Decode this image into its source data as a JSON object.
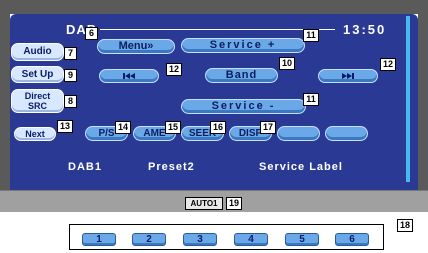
{
  "header": {
    "title": "DAB",
    "time": "13:50"
  },
  "side_buttons": {
    "audio": "Audio",
    "setup": "Set Up",
    "direct_line1": "Direct",
    "direct_line2": "SRC"
  },
  "top_buttons": {
    "menu": "Menu»",
    "service_up": "Service +",
    "band": "Band",
    "service_down": "Service -"
  },
  "function_row": {
    "next": "Next",
    "ps": "P/S",
    "am": "AME",
    "seek": "SEEK",
    "disp": "DISP",
    "blank1": "",
    "blank2": ""
  },
  "info": {
    "band": "DAB1",
    "preset": "Preset2",
    "service": "Service Label"
  },
  "auto": "AUTO1",
  "presets": [
    "1",
    "2",
    "3",
    "4",
    "5",
    "6"
  ],
  "callouts": {
    "c6": "6",
    "c7": "7",
    "c8": "8",
    "c9": "9",
    "c10": "10",
    "c11a": "11",
    "c11b": "11",
    "c12a": "12",
    "c12b": "12",
    "c13": "13",
    "c14": "14",
    "c15": "15",
    "c16": "16",
    "c17": "17",
    "c18": "18",
    "c19": "19"
  },
  "colors": {
    "display_bg": "#2a3a94",
    "button": "#6aa8e8",
    "accent": "#48b8f0",
    "frame": "#5a5a5a"
  }
}
